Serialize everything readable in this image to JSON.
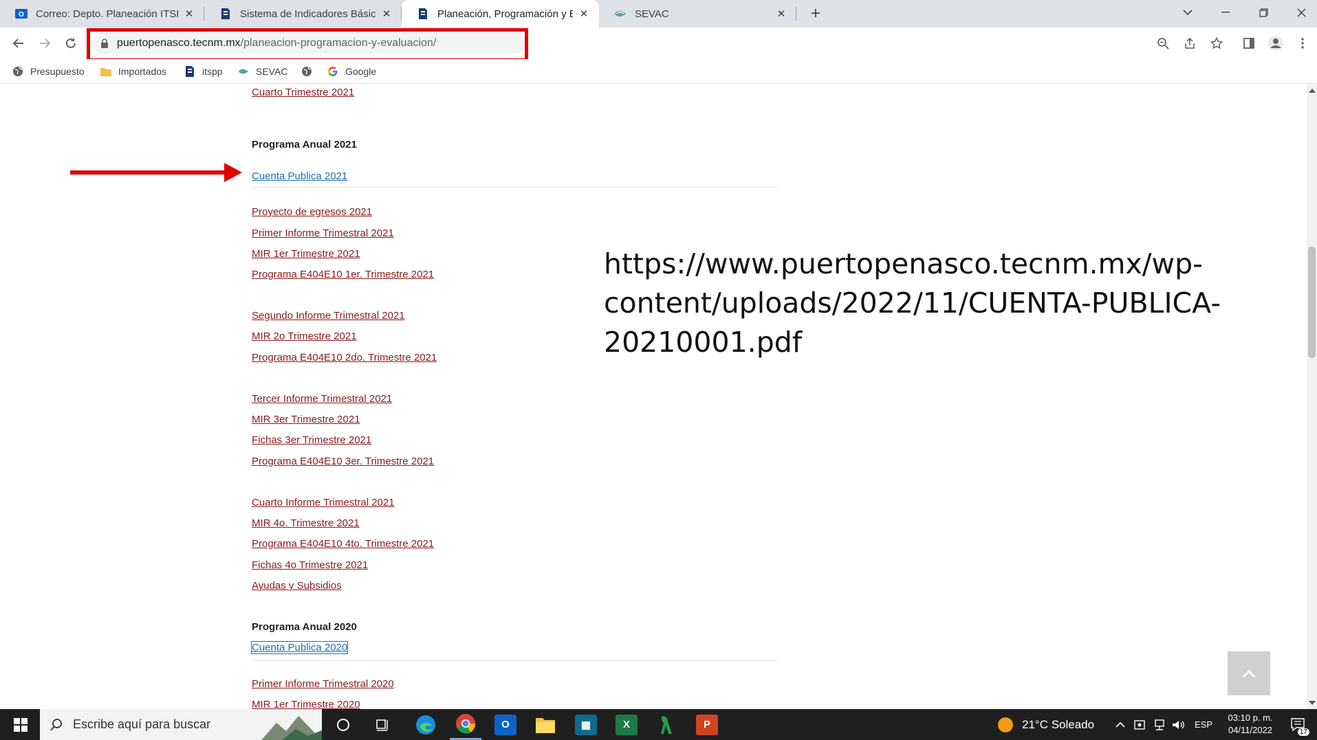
{
  "tabs": [
    {
      "label": "Correo: Depto. Planeación ITSPP",
      "icon": "outlook-icon",
      "active": false
    },
    {
      "label": "Sistema de Indicadores Básicos",
      "icon": "tecnm-icon",
      "active": false
    },
    {
      "label": "Planeación, Programación y Evalu",
      "icon": "tecnm-icon",
      "active": true
    },
    {
      "label": "SEVAC",
      "icon": "sevac-icon",
      "active": false
    }
  ],
  "omnibox": {
    "host": "puertopenasco.tecnm.mx",
    "path": "/planeacion-programacion-y-evaluacion/"
  },
  "bookmarks": [
    {
      "label": "Presupuesto",
      "icon": "globe-icon"
    },
    {
      "label": "Importados",
      "icon": "folder-icon"
    },
    {
      "label": "itspp",
      "icon": "tecnm-icon"
    },
    {
      "label": "SEVAC",
      "icon": "sevac-icon"
    },
    {
      "label": "",
      "icon": "globe-icon"
    },
    {
      "label": "Google",
      "icon": "google-icon"
    }
  ],
  "page": {
    "links_top": [
      "Cuarto Trimestre 2021"
    ],
    "section_2021": {
      "heading": "Programa Anual 2021",
      "cuenta": "Cuenta Publica 2021",
      "links": [
        "Proyecto de egresos 2021",
        "Primer Informe Trimestral 2021",
        "MIR 1er Trimestre 2021",
        "Programa E404E10 1er. Trimestre 2021",
        "Segundo Informe Trimestral 2021",
        "MIR 2o Trimestre 2021",
        "Programa E404E10 2do. Trimestre 2021",
        "Tercer Informe Trimestral 2021",
        "MIR 3er Trimestre 2021",
        "Fichas 3er Trimestre 2021",
        "Programa E404E10 3er. Trimestre 2021",
        "Cuarto Informe Trimestral 2021",
        "MIR 4o. Trimestre 2021",
        "Programa E404E10 4to. Trimestre 2021",
        "Fichas 4o Trimestre 2021",
        "Ayudas y Subsidios"
      ]
    },
    "section_2020": {
      "heading": "Programa Anual 2020",
      "cuenta": "Cuenta Publica 2020",
      "links": [
        "Primer Informe Trimestral 2020",
        "MIR 1er Trimestre 2020"
      ]
    },
    "annotation_lines": [
      "https://www.puertopenasco.tecnm.mx/wp-",
      "content/uploads/2022/11/CUENTA-PUBLICA-",
      "20210001.pdf"
    ]
  },
  "taskbar": {
    "search_placeholder": "Escribe aquí para buscar",
    "weather": "21°C  Soleado",
    "language": "ESP",
    "time": "03:10 p. m.",
    "date": "04/11/2022",
    "notifications": "17"
  },
  "colors": {
    "highlight": "#e00000",
    "link": "#8b1a1a",
    "link_active": "#1a6fb5"
  }
}
